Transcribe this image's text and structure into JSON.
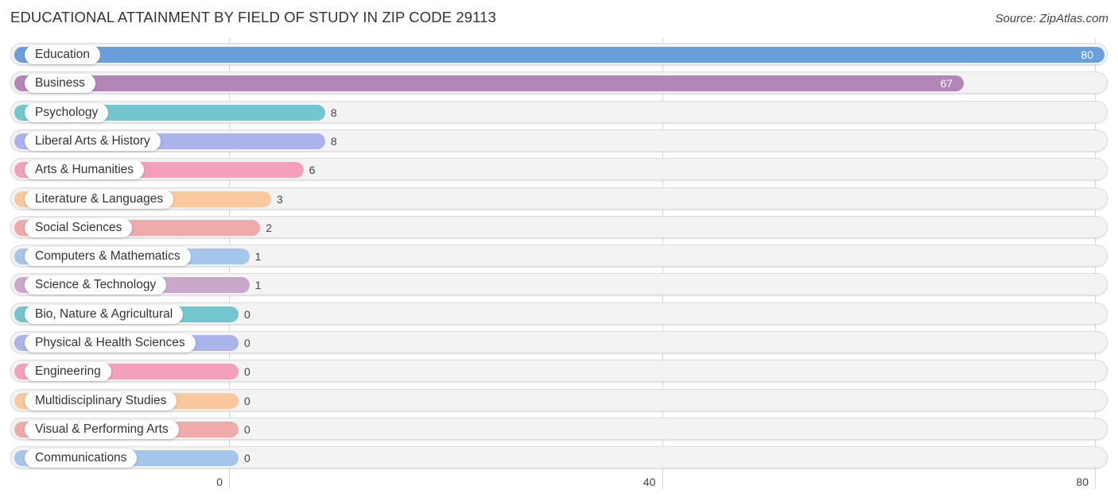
{
  "title": "EDUCATIONAL ATTAINMENT BY FIELD OF STUDY IN ZIP CODE 29113",
  "source": "Source: ZipAtlas.com",
  "chart_data": {
    "type": "bar",
    "orientation": "horizontal",
    "title": "EDUCATIONAL ATTAINMENT BY FIELD OF STUDY IN ZIP CODE 29113",
    "xlabel": "",
    "ylabel": "",
    "xlim": [
      0,
      80
    ],
    "xticks": [
      0,
      40,
      80
    ],
    "xtick_labels": [
      "0",
      "40",
      "80"
    ],
    "grid": true,
    "categories": [
      "Education",
      "Business",
      "Psychology",
      "Liberal Arts & History",
      "Arts & Humanities",
      "Literature & Languages",
      "Social Sciences",
      "Computers & Mathematics",
      "Science & Technology",
      "Bio, Nature & Agricultural",
      "Physical & Health Sciences",
      "Engineering",
      "Multidisciplinary Studies",
      "Visual & Performing Arts",
      "Communications"
    ],
    "values": [
      80,
      67,
      8,
      8,
      6,
      3,
      2,
      1,
      1,
      0,
      0,
      0,
      0,
      0,
      0
    ],
    "value_labels": [
      "80",
      "67",
      "8",
      "8",
      "6",
      "3",
      "2",
      "1",
      "1",
      "0",
      "0",
      "0",
      "0",
      "0",
      "0"
    ],
    "colors": [
      "#6a9fdc",
      "#b486b8",
      "#74c6ce",
      "#aab4ea",
      "#f49fbc",
      "#f9c89c",
      "#efaaaa",
      "#a5c6ec",
      "#caa8cc",
      "#74c6ce",
      "#aab4ea",
      "#f49fbc",
      "#f9c89c",
      "#efaaaa",
      "#a5c6ec"
    ]
  }
}
